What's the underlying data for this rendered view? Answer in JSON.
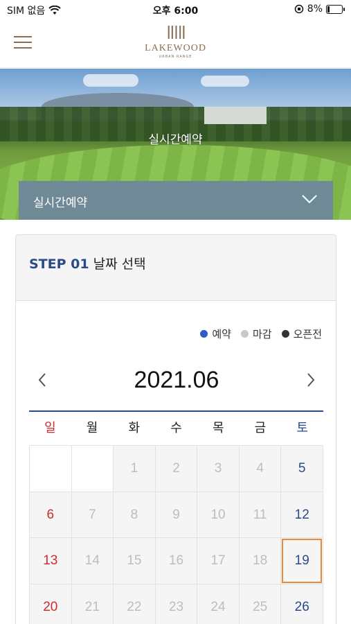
{
  "status_bar": {
    "carrier": "SIM 없음",
    "time": "오후 6:00",
    "battery": "8%"
  },
  "header": {
    "logo_name": "LAKEWOOD",
    "logo_sub": "URBAN RANGE"
  },
  "hero": {
    "title": "실시간예약",
    "select_label": "실시간예약"
  },
  "step": {
    "number": "STEP 01",
    "title": "날짜 선택"
  },
  "legend": [
    {
      "label": "예약",
      "color": "#2f5bc4"
    },
    {
      "label": "마감",
      "color": "#c8c8c8"
    },
    {
      "label": "오픈전",
      "color": "#333333"
    }
  ],
  "calendar": {
    "month_title": "2021.06",
    "weekdays": [
      "일",
      "월",
      "화",
      "수",
      "목",
      "금",
      "토"
    ],
    "selected_day": "19",
    "weeks": [
      [
        "",
        "",
        "1",
        "2",
        "3",
        "4",
        "5"
      ],
      [
        "6",
        "7",
        "8",
        "9",
        "10",
        "11",
        "12"
      ],
      [
        "13",
        "14",
        "15",
        "16",
        "17",
        "18",
        "19"
      ],
      [
        "20",
        "21",
        "22",
        "23",
        "24",
        "25",
        "26"
      ]
    ]
  },
  "colors": {
    "accent_navy": "#2a4a8a",
    "sunday_red": "#d02a2a",
    "selected_orange": "#e88b3a",
    "brand_brown": "#8a6f55"
  }
}
